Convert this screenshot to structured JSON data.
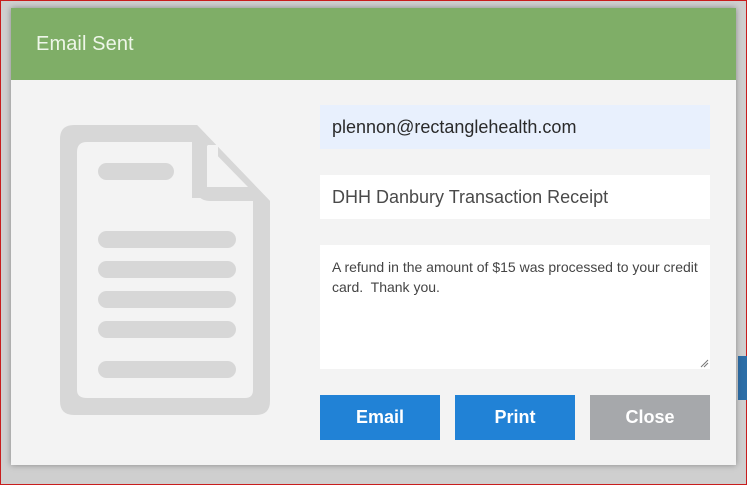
{
  "dialog": {
    "title": "Email Sent",
    "email_value": "plennon@rectanglehealth.com",
    "subject_value": "DHH Danbury Transaction Receipt",
    "message_value": "A refund in the amount of $15 was processed to your credit card.  Thank you."
  },
  "buttons": {
    "email_label": "Email",
    "print_label": "Print",
    "close_label": "Close"
  },
  "icons": {
    "document": "document-icon",
    "resize": "resize-grip-icon"
  },
  "colors": {
    "header": "#7fae67",
    "primary_button": "#2182d6",
    "secondary_button": "#a6a8ab",
    "email_field": "#e8f0fd",
    "document_icon": "#d7d7d7"
  }
}
